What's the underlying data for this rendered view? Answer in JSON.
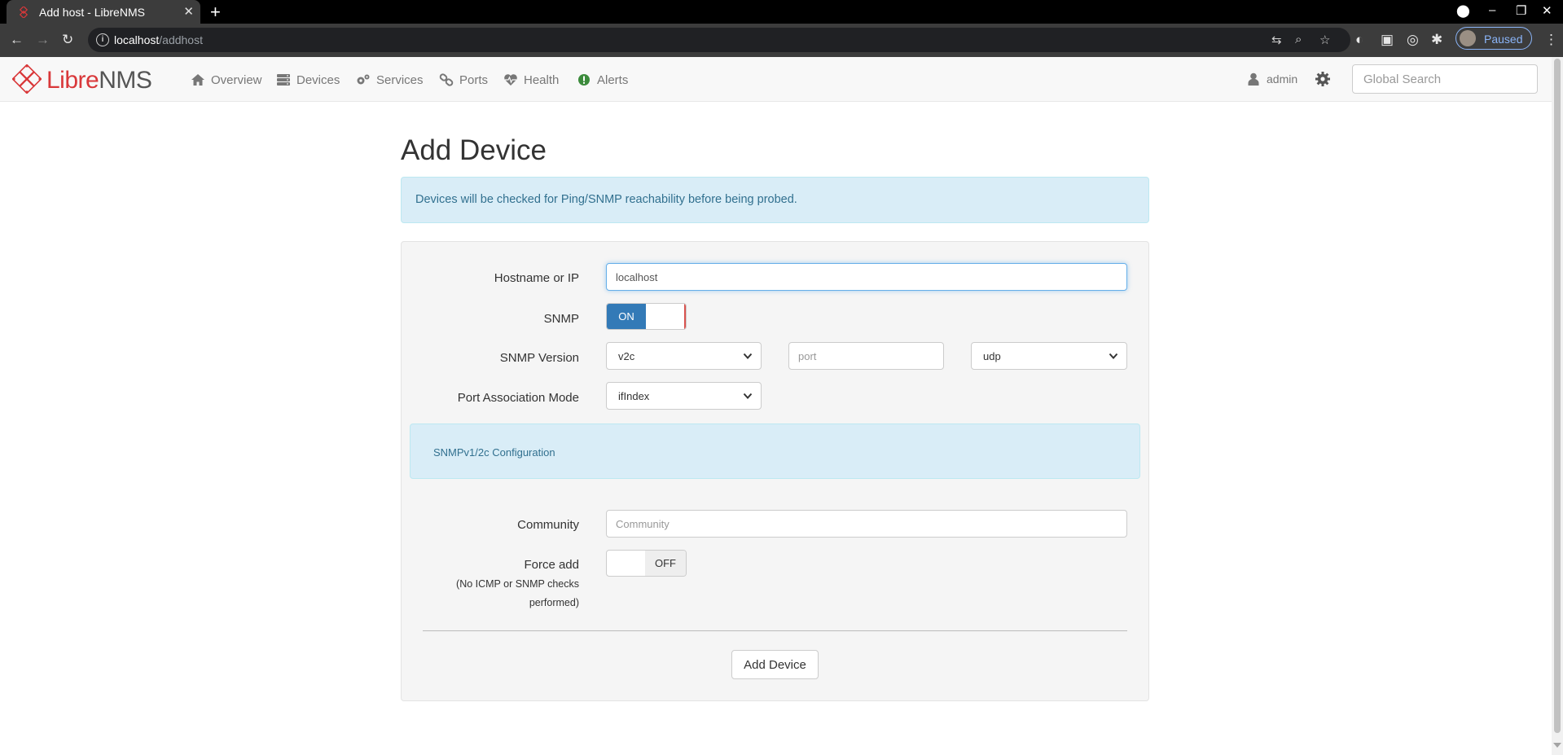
{
  "browser": {
    "tab_title": "Add host - LibreNMS",
    "url_host": "localhost",
    "url_path": "/addhost",
    "profile_label": "Paused"
  },
  "navbar": {
    "logo_libre": "Libre",
    "logo_nms": "NMS",
    "items": [
      {
        "label": "Overview",
        "icon": "home-icon"
      },
      {
        "label": "Devices",
        "icon": "server-icon"
      },
      {
        "label": "Services",
        "icon": "cogs-icon"
      },
      {
        "label": "Ports",
        "icon": "link-icon"
      },
      {
        "label": "Health",
        "icon": "heartbeat-icon"
      },
      {
        "label": "Alerts",
        "icon": "exclamation-circle-icon"
      }
    ],
    "user": "admin",
    "search_placeholder": "Global Search"
  },
  "page": {
    "title": "Add Device",
    "info": "Devices will be checked for Ping/SNMP reachability before being probed."
  },
  "form": {
    "hostname_label": "Hostname or IP",
    "hostname_value": "localhost",
    "snmp_label": "SNMP",
    "snmp_toggle": "ON",
    "snmp_version_label": "SNMP Version",
    "snmp_version_value": "v2c",
    "port_placeholder": "port",
    "transport_value": "udp",
    "port_assoc_label": "Port Association Mode",
    "port_assoc_value": "ifIndex",
    "snmp_config_heading": "SNMPv1/2c Configuration",
    "community_label": "Community",
    "community_placeholder": "Community",
    "force_add_label": "Force add",
    "force_add_note_1": "(No ICMP or SNMP checks",
    "force_add_note_2": "performed)",
    "force_add_toggle": "OFF",
    "submit_label": "Add Device"
  },
  "colors": {
    "brand_red": "#d9383a",
    "primary_blue": "#337ab7",
    "info_bg": "#d9edf7",
    "info_text": "#31708f"
  }
}
